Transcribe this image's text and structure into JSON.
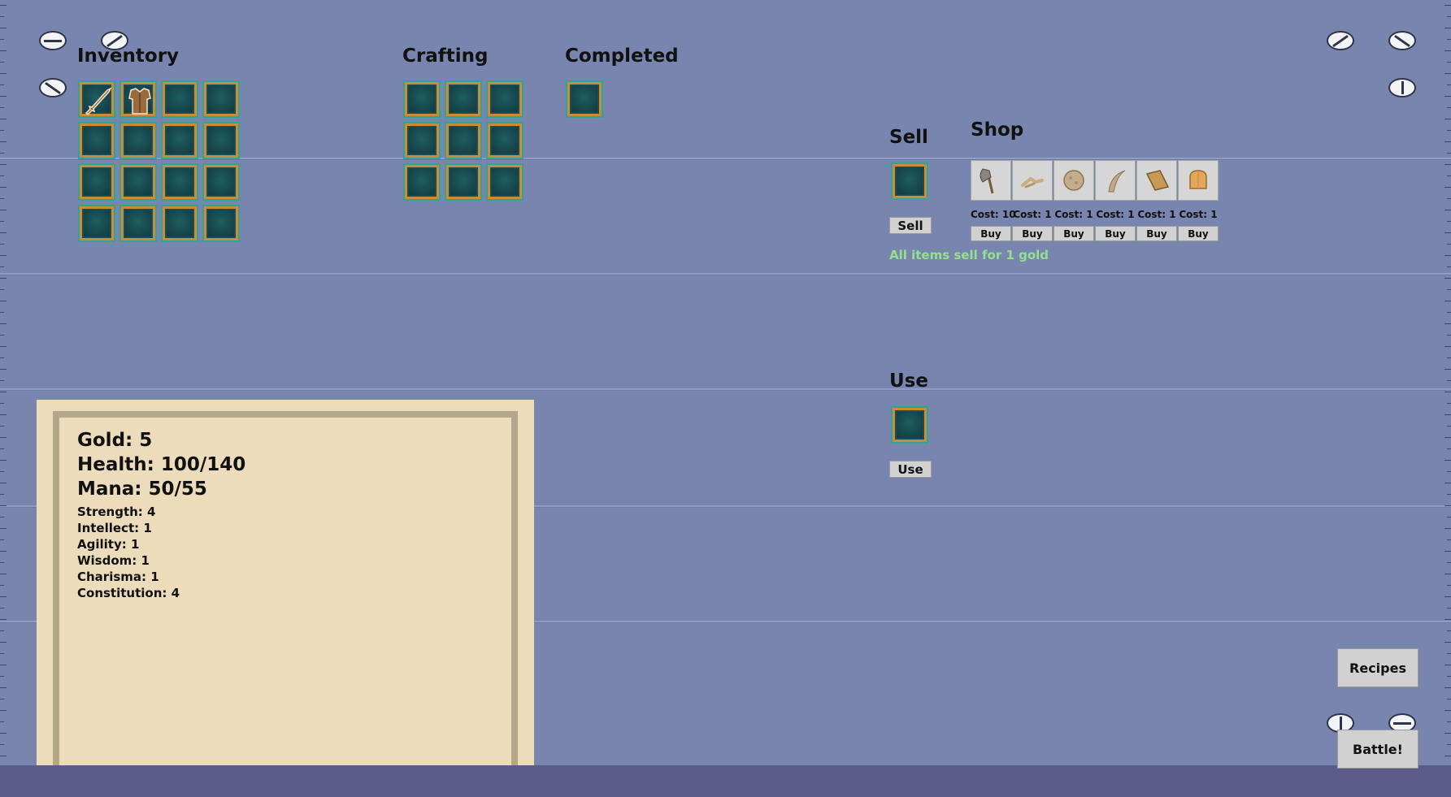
{
  "sections": {
    "inventory": "Inventory",
    "crafting": "Crafting",
    "completed": "Completed",
    "sell": "Sell",
    "shop": "Shop",
    "use": "Use"
  },
  "inventory": {
    "slots": [
      "sword-icon",
      "armor-icon",
      "",
      "",
      "",
      "",
      "",
      "",
      "",
      "",
      "",
      "",
      "",
      "",
      "",
      ""
    ]
  },
  "sell": {
    "button_label": "Sell",
    "note": "All items sell for 1 gold",
    "note_color": "#95e08f"
  },
  "use": {
    "button_label": "Use"
  },
  "shop": {
    "items": [
      {
        "icon": "axe-icon",
        "cost": "Cost: 10",
        "buy_label": "Buy"
      },
      {
        "icon": "bones-icon",
        "cost": "Cost: 1",
        "buy_label": "Buy"
      },
      {
        "icon": "stone-icon",
        "cost": "Cost: 1",
        "buy_label": "Buy"
      },
      {
        "icon": "horn-icon",
        "cost": "Cost: 1",
        "buy_label": "Buy"
      },
      {
        "icon": "leather-icon",
        "cost": "Cost: 1",
        "buy_label": "Buy"
      },
      {
        "icon": "bread-icon",
        "cost": "Cost: 1",
        "buy_label": "Buy"
      }
    ]
  },
  "stats": {
    "gold": "Gold: 5",
    "health": "Health: 100/140",
    "mana": "Mana: 50/55",
    "strength": "Strength: 4",
    "intellect": "Intellect: 1",
    "agility": "Agility: 1",
    "wisdom": "Wisdom: 1",
    "charisma": "Charisma: 1",
    "constitution": "Constitution: 4"
  },
  "buttons": {
    "recipes": "Recipes",
    "battle": "Battle!"
  },
  "colors": {
    "background": "#7885ae",
    "slot_teal": "#2fa493",
    "slot_gold": "#c98c3a",
    "panel": "#ecdcbc"
  }
}
